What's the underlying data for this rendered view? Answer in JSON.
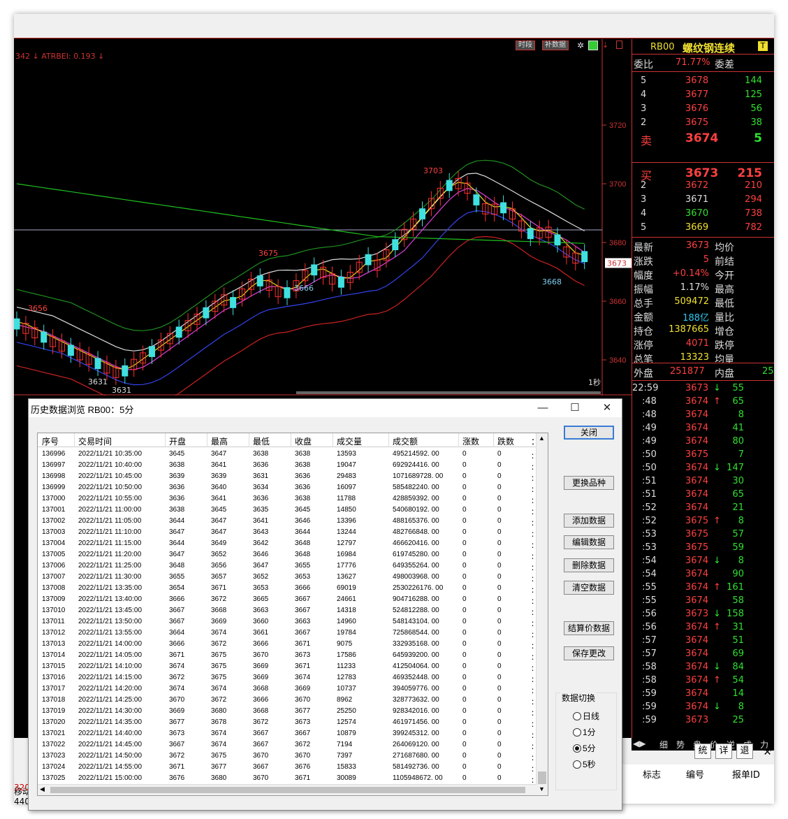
{
  "chart": {
    "indicator_label": "342 ↓ ATRBEI: 0.193 ↓",
    "buttons": {
      "period": "时段",
      "supplement": "补数据"
    },
    "yticks": [
      "3720",
      "3700",
      "3680",
      "3660",
      "3640"
    ],
    "current_price_tag": "3673",
    "annotations": {
      "high": "3703",
      "h2": "3675",
      "low1": "3666",
      "low2": "3668",
      "left_h": "3656",
      "left_l1": "3631",
      "left_l2": "3631"
    },
    "timer_label": "1秒",
    "period_label": "5分"
  },
  "quote": {
    "code": "RB00",
    "name": "螺纹钢连续",
    "weibi_label": "委比",
    "weibi_value": "71.77%",
    "weicha_label": "委差",
    "asks": [
      {
        "level": "5",
        "price": "3678",
        "vol": "144"
      },
      {
        "level": "4",
        "price": "3677",
        "vol": "125"
      },
      {
        "level": "3",
        "price": "3676",
        "vol": "56"
      },
      {
        "level": "2",
        "price": "3675",
        "vol": "38"
      },
      {
        "level": "卖",
        "price": "3674",
        "vol": "5"
      }
    ],
    "bids": [
      {
        "level": "买",
        "price": "3673",
        "vol": "215"
      },
      {
        "level": "2",
        "price": "3672",
        "vol": "210"
      },
      {
        "level": "3",
        "price": "3671",
        "vol": "294"
      },
      {
        "level": "4",
        "price": "3670",
        "vol": "738"
      },
      {
        "level": "5",
        "price": "3669",
        "vol": "782"
      }
    ],
    "stats": [
      {
        "l": "最新",
        "v": "3673",
        "r": "均价",
        "c": "red"
      },
      {
        "l": "涨跌",
        "v": "5",
        "r": "前结",
        "c": "red"
      },
      {
        "l": "幅度",
        "v": "+0.14%",
        "r": "今开",
        "c": "red"
      },
      {
        "l": "振幅",
        "v": "1.17%",
        "r": "最高",
        "c": "wht"
      },
      {
        "l": "总手",
        "v": "509472",
        "r": "最低",
        "c": "yel"
      },
      {
        "l": "金额",
        "v": "188亿",
        "r": "量比",
        "c": "cyn"
      },
      {
        "l": "持仓",
        "v": "1387665",
        "r": "增仓",
        "c": "yel"
      },
      {
        "l": "涨停",
        "v": "4071",
        "r": "跌停",
        "c": "red"
      },
      {
        "l": "总笔",
        "v": "13323",
        "r": "均量",
        "c": "yel"
      }
    ],
    "waipan_label": "外盘",
    "waipan_value": "251877",
    "neipan_label": "内盘",
    "neipan_value": "25",
    "ticks": [
      {
        "t": "22:59",
        "p": "3673",
        "a": "↓",
        "v": "55"
      },
      {
        "t": ":48",
        "p": "3674",
        "a": "↑",
        "v": "65"
      },
      {
        "t": ":48",
        "p": "3674",
        "a": "",
        "v": "8"
      },
      {
        "t": ":49",
        "p": "3674",
        "a": "",
        "v": "41"
      },
      {
        "t": ":49",
        "p": "3674",
        "a": "",
        "v": "80"
      },
      {
        "t": ":50",
        "p": "3675",
        "a": "",
        "v": "7"
      },
      {
        "t": ":50",
        "p": "3674",
        "a": "↓",
        "v": "147"
      },
      {
        "t": ":51",
        "p": "3674",
        "a": "",
        "v": "30"
      },
      {
        "t": ":51",
        "p": "3674",
        "a": "",
        "v": "65"
      },
      {
        "t": ":52",
        "p": "3674",
        "a": "",
        "v": "21"
      },
      {
        "t": ":52",
        "p": "3675",
        "a": "↑",
        "v": "8"
      },
      {
        "t": ":53",
        "p": "3675",
        "a": "",
        "v": "57"
      },
      {
        "t": ":53",
        "p": "3675",
        "a": "",
        "v": "59"
      },
      {
        "t": ":54",
        "p": "3674",
        "a": "↓",
        "v": "8"
      },
      {
        "t": ":54",
        "p": "3674",
        "a": "",
        "v": "90"
      },
      {
        "t": ":55",
        "p": "3674",
        "a": "↑",
        "v": "161"
      },
      {
        "t": ":55",
        "p": "3674",
        "a": "",
        "v": "58"
      },
      {
        "t": ":56",
        "p": "3673",
        "a": "↓",
        "v": "158"
      },
      {
        "t": ":56",
        "p": "3674",
        "a": "↑",
        "v": "31"
      },
      {
        "t": ":57",
        "p": "3674",
        "a": "",
        "v": "51"
      },
      {
        "t": ":57",
        "p": "3674",
        "a": "",
        "v": "69"
      },
      {
        "t": ":58",
        "p": "3674",
        "a": "↓",
        "v": "84"
      },
      {
        "t": ":58",
        "p": "3674",
        "a": "↑",
        "v": "54"
      },
      {
        "t": ":59",
        "p": "3674",
        "a": "",
        "v": "14"
      },
      {
        "t": ":59",
        "p": "3674",
        "a": "↓",
        "v": "8"
      },
      {
        "t": ":59",
        "p": "3673",
        "a": "",
        "v": "25"
      }
    ],
    "tabs": [
      "细",
      "势",
      "盘",
      "价",
      "逆",
      "成",
      "力"
    ],
    "side_buttons": [
      "统",
      "详",
      "退"
    ]
  },
  "bottom": {
    "headers": [
      "标志",
      "编号",
      "报单ID"
    ],
    "left_frags": [
      "移动",
      "320",
      "440"
    ]
  },
  "dialog": {
    "title": "历史数据浏览 RB00：5分",
    "columns": [
      "序号",
      "交易时间",
      "开盘",
      "最高",
      "最低",
      "收盘",
      "成交量",
      "成交额",
      "涨数",
      "跌数"
    ],
    "rows": [
      [
        "136996",
        "2022/11/21  10:35:00",
        "3645",
        "3647",
        "3638",
        "3638",
        "13593",
        "495214592. 00",
        "0",
        "0"
      ],
      [
        "136997",
        "2022/11/21  10:40:00",
        "3638",
        "3641",
        "3636",
        "3638",
        "19047",
        "692924416. 00",
        "0",
        "0"
      ],
      [
        "136998",
        "2022/11/21  10:45:00",
        "3639",
        "3639",
        "3631",
        "3636",
        "29483",
        "1071689728. 00",
        "0",
        "0"
      ],
      [
        "136999",
        "2022/11/21  10:50:00",
        "3636",
        "3640",
        "3634",
        "3636",
        "16097",
        "585482240. 00",
        "0",
        "0"
      ],
      [
        "137000",
        "2022/11/21  10:55:00",
        "3636",
        "3641",
        "3636",
        "3638",
        "11788",
        "428859392. 00",
        "0",
        "0"
      ],
      [
        "137001",
        "2022/11/21  11:00:00",
        "3638",
        "3645",
        "3635",
        "3645",
        "14850",
        "540680192. 00",
        "0",
        "0"
      ],
      [
        "137002",
        "2022/11/21  11:05:00",
        "3644",
        "3647",
        "3641",
        "3646",
        "13396",
        "488165376. 00",
        "0",
        "0"
      ],
      [
        "137003",
        "2022/11/21  11:10:00",
        "3647",
        "3647",
        "3643",
        "3644",
        "13244",
        "482766848. 00",
        "0",
        "0"
      ],
      [
        "137004",
        "2022/11/21  11:15:00",
        "3644",
        "3649",
        "3642",
        "3648",
        "12797",
        "466620416. 00",
        "0",
        "0"
      ],
      [
        "137005",
        "2022/11/21  11:20:00",
        "3647",
        "3652",
        "3646",
        "3648",
        "16984",
        "619745280. 00",
        "0",
        "0"
      ],
      [
        "137006",
        "2022/11/21  11:25:00",
        "3648",
        "3656",
        "3647",
        "3655",
        "17776",
        "649355264. 00",
        "0",
        "0"
      ],
      [
        "137007",
        "2022/11/21  11:30:00",
        "3655",
        "3657",
        "3652",
        "3653",
        "13627",
        "498003968. 00",
        "0",
        "0"
      ],
      [
        "137008",
        "2022/11/21  13:35:00",
        "3654",
        "3671",
        "3653",
        "3666",
        "69019",
        "2530226176. 00",
        "0",
        "0"
      ],
      [
        "137009",
        "2022/11/21  13:40:00",
        "3666",
        "3672",
        "3665",
        "3667",
        "24661",
        "904716288. 00",
        "0",
        "0"
      ],
      [
        "137010",
        "2022/11/21  13:45:00",
        "3667",
        "3668",
        "3663",
        "3667",
        "14318",
        "524812288. 00",
        "0",
        "0"
      ],
      [
        "137011",
        "2022/11/21  13:50:00",
        "3667",
        "3669",
        "3660",
        "3663",
        "14960",
        "548143104. 00",
        "0",
        "0"
      ],
      [
        "137012",
        "2022/11/21  13:55:00",
        "3664",
        "3674",
        "3661",
        "3667",
        "19784",
        "725868544. 00",
        "0",
        "0"
      ],
      [
        "137013",
        "2022/11/21  14:00:00",
        "3666",
        "3672",
        "3666",
        "3671",
        "9075",
        "332935168. 00",
        "0",
        "0"
      ],
      [
        "137014",
        "2022/11/21  14:05:00",
        "3671",
        "3675",
        "3670",
        "3673",
        "17586",
        "645939200. 00",
        "0",
        "0"
      ],
      [
        "137015",
        "2022/11/21  14:10:00",
        "3674",
        "3675",
        "3669",
        "3671",
        "11233",
        "412504064. 00",
        "0",
        "0"
      ],
      [
        "137016",
        "2022/11/21  14:15:00",
        "3672",
        "3675",
        "3669",
        "3674",
        "12783",
        "469352448. 00",
        "0",
        "0"
      ],
      [
        "137017",
        "2022/11/21  14:20:00",
        "3674",
        "3674",
        "3668",
        "3669",
        "10737",
        "394059776. 00",
        "0",
        "0"
      ],
      [
        "137018",
        "2022/11/21  14:25:00",
        "3670",
        "3672",
        "3666",
        "3670",
        "8962",
        "328773632. 00",
        "0",
        "0"
      ],
      [
        "137019",
        "2022/11/21  14:30:00",
        "3669",
        "3680",
        "3668",
        "3677",
        "25250",
        "928342016. 00",
        "0",
        "0"
      ],
      [
        "137020",
        "2022/11/21  14:35:00",
        "3677",
        "3678",
        "3672",
        "3673",
        "12574",
        "461971456. 00",
        "0",
        "0"
      ],
      [
        "137021",
        "2022/11/21  14:40:00",
        "3673",
        "3674",
        "3667",
        "3667",
        "10879",
        "399245312. 00",
        "0",
        "0"
      ],
      [
        "137022",
        "2022/11/21  14:45:00",
        "3667",
        "3674",
        "3667",
        "3672",
        "7194",
        "264069120. 00",
        "0",
        "0"
      ],
      [
        "137023",
        "2022/11/21  14:50:00",
        "3672",
        "3675",
        "3670",
        "3670",
        "7397",
        "271687680. 00",
        "0",
        "0"
      ],
      [
        "137024",
        "2022/11/21  14:55:00",
        "3671",
        "3677",
        "3667",
        "3676",
        "15833",
        "581492736. 00",
        "0",
        "0"
      ],
      [
        "137025",
        "2022/11/21  15:00:00",
        "3676",
        "3680",
        "3670",
        "3671",
        "30089",
        "1105948672. 00",
        "0",
        "0"
      ]
    ],
    "buttons": [
      "关闭",
      "更换品种",
      "添加数据",
      "编辑数据",
      "删除数据",
      "清空数据",
      "结算价数据",
      "保存更改"
    ],
    "switch_label": "数据切换",
    "radios": [
      "日线",
      "1分",
      "5分",
      "5秒"
    ],
    "selected_radio": "5分"
  }
}
